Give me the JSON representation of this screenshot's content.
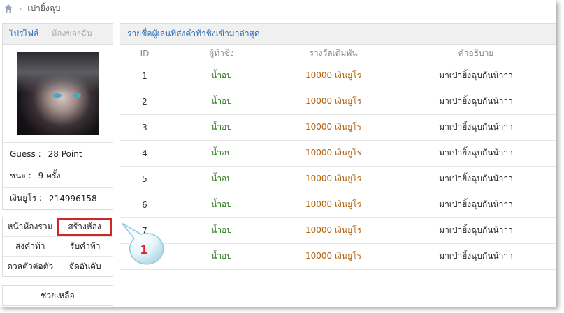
{
  "breadcrumb": {
    "current": "เป่ายิ้งฉุบ"
  },
  "profile": {
    "tabs": [
      "โปรไฟล์",
      "ห้องของฉัน"
    ],
    "stats": [
      {
        "label": "Guess :",
        "value": "28 Point"
      },
      {
        "label": "ชนะ :",
        "value": "9 ครั้ง"
      },
      {
        "label": "เงินยูโร :",
        "value": "214996158"
      }
    ]
  },
  "menu": {
    "items": [
      [
        "หน้าห้องรวม",
        "สร้างห้อง"
      ],
      [
        "ส่งคำท้า",
        "รับคำท้า"
      ],
      [
        "ดวลตัวต่อตัว",
        "จัดอันดับ"
      ]
    ],
    "help": "ช่วยเหลือ"
  },
  "main": {
    "title": "รายชื่อผู้เล่นที่ส่งคำท้าชิงเข้ามาล่าสุด",
    "columns": [
      "ID",
      "ผู้ท้าชิง",
      "รางวัลเดิมพัน",
      "คำอธิบาย"
    ],
    "rows": [
      {
        "id": "1",
        "challenger": "น้ำอบ",
        "reward": "10000 เงินยูโร",
        "desc": "มาเป่ายิ้งฉุบกันน้าาา"
      },
      {
        "id": "2",
        "challenger": "น้ำอบ",
        "reward": "10000 เงินยูโร",
        "desc": "มาเป่ายิ้งฉุบกันน้าาา"
      },
      {
        "id": "3",
        "challenger": "น้ำอบ",
        "reward": "10000 เงินยูโร",
        "desc": "มาเป่ายิ้งฉุบกันน้าาา"
      },
      {
        "id": "4",
        "challenger": "น้ำอบ",
        "reward": "10000 เงินยูโร",
        "desc": "มาเป่ายิ้งฉุบกันน้าาา"
      },
      {
        "id": "5",
        "challenger": "น้ำอบ",
        "reward": "10000 เงินยูโร",
        "desc": "มาเป่ายิ้งฉุบกันน้าาา"
      },
      {
        "id": "6",
        "challenger": "น้ำอบ",
        "reward": "10000 เงินยูโร",
        "desc": "มาเป่ายิ้งฉุบกันน้าาา"
      },
      {
        "id": "7",
        "challenger": "น้ำอบ",
        "reward": "10000 เงินยูโร",
        "desc": "มาเป่ายิ้งฉุบกันน้าาา"
      },
      {
        "id": "8",
        "challenger": "น้ำอบ",
        "reward": "10000 เงินยูโร",
        "desc": "มาเป่ายิ้งฉุบกันน้าาา"
      }
    ]
  },
  "callout": {
    "number": "1"
  },
  "colors": {
    "link_blue": "#2f6fb8",
    "challenger_green": "#2e7d1e",
    "reward_orange": "#b8620a",
    "highlight_red": "#d42525",
    "callout_red": "#e0202a"
  }
}
